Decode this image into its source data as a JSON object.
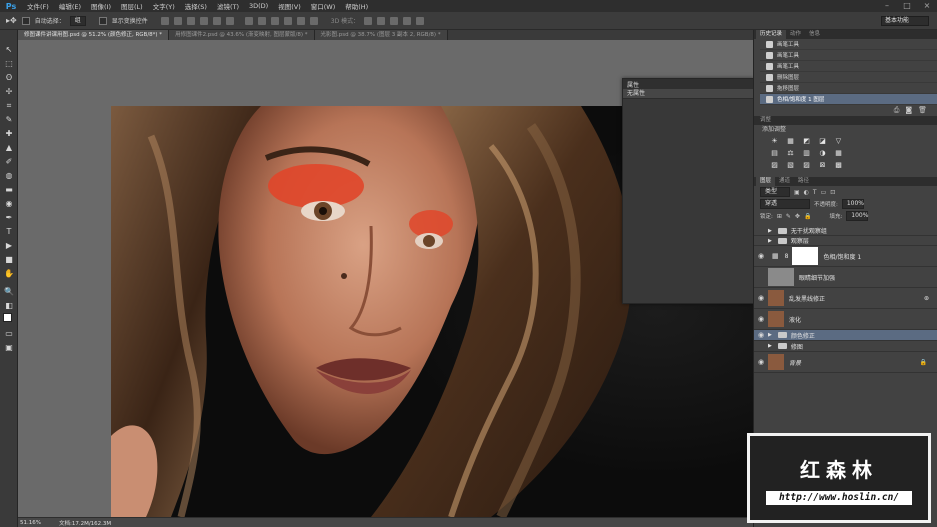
{
  "app": {
    "logo": "Ps"
  },
  "menubar": {
    "items": [
      "文件(F)",
      "编辑(E)",
      "图像(I)",
      "图层(L)",
      "文字(Y)",
      "选择(S)",
      "滤镜(T)",
      "3D(D)",
      "视图(V)",
      "窗口(W)",
      "帮助(H)"
    ],
    "controls": [
      "–",
      "□",
      "×"
    ]
  },
  "options_bar": {
    "auto_select_label": "自动选择：",
    "auto_select_value": "组",
    "show_transform_label": "显示变换控件",
    "mode_label": "3D 模式：",
    "workspace": "基本功能"
  },
  "tabs": [
    {
      "label": "修图课件讲课用图.psd @ 51.2% (颜色修正, RGB/8*) *",
      "active": true
    },
    {
      "label": "用修图课件2.psd @ 43.6% (渐变映射, 图层蒙版/8) *",
      "active": false
    },
    {
      "label": "光影图.psd @ 38.7% (图层 3 副本 2, RGB/8) *",
      "active": false
    }
  ],
  "tools": [
    "↖",
    "⬚",
    "ʘ",
    "✢",
    "⌗",
    "✎",
    "✚",
    "▲",
    "✐",
    "◍",
    "▬",
    "◉",
    "✒",
    "T",
    "▶",
    "■",
    "✋",
    "🔍",
    "◧",
    "▭",
    "▣"
  ],
  "status": {
    "zoom": "51.16%",
    "doc": "文档:17.2M/162.3M"
  },
  "properties": {
    "title": "属性",
    "value": "无属性"
  },
  "history": {
    "tabs": [
      "历史记录",
      "动作",
      "信息"
    ],
    "items": [
      "画笔工具",
      "画笔工具",
      "画笔工具",
      "删除图层",
      "拖移图层",
      "色相/饱和度 1 图层"
    ]
  },
  "adjustments": {
    "title": "添加调整",
    "row1": [
      "☀",
      "▦",
      "◩",
      "◪",
      "▽"
    ],
    "row2": [
      "▤",
      "⚖",
      "▥",
      "◑",
      "▦"
    ],
    "row3": [
      "▨",
      "▧",
      "▨",
      "⊠",
      "▩"
    ]
  },
  "layers": {
    "tabs": [
      "图层",
      "通道",
      "路径"
    ],
    "kind_label": "类型",
    "blend_mode": "穿透",
    "opacity_label": "不透明度:",
    "opacity": "100%",
    "lock_label": "锁定:",
    "fill_label": "填充:",
    "fill": "100%",
    "rows": [
      {
        "name": "无干扰观察组",
        "type": "group"
      },
      {
        "name": "观察层",
        "type": "group"
      },
      {
        "name": "色相/饱和度 1",
        "type": "adjustment"
      },
      {
        "name": "眼睛细节加强",
        "type": "layer"
      },
      {
        "name": "乱发黑线修正",
        "type": "photo"
      },
      {
        "name": "液化",
        "type": "photo"
      },
      {
        "name": "颜色修正",
        "type": "group",
        "selected": true
      },
      {
        "name": "修图",
        "type": "group"
      },
      {
        "name": "背景",
        "type": "photo"
      }
    ]
  },
  "watermark": {
    "title": "红森林",
    "url": "http://www.hoslin.cn/"
  },
  "colors": {
    "accent": "#5b6b82",
    "ps_blue": "#3aa0e8",
    "eyeshadow": "#e0462a"
  }
}
